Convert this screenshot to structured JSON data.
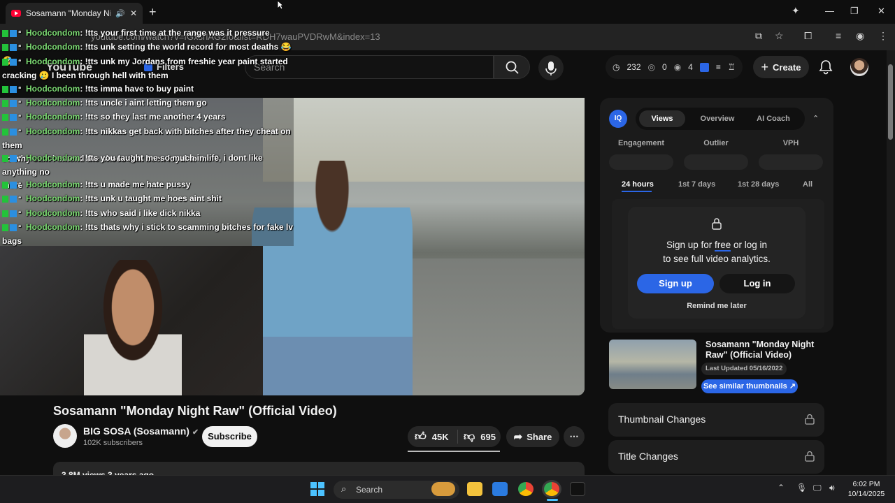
{
  "browser": {
    "tab_title": "Sosamann \"Monday Night R",
    "url": "youtube.com/watch?v=fGxsrlAG2fo&list=RDH7wauPVDRwM&index=13"
  },
  "masthead": {
    "logo": "YouTube",
    "filters_label": "Filters",
    "search_placeholder": "Search",
    "stats": {
      "clock": "232",
      "views": "0",
      "eye": "4"
    },
    "create_label": "Create"
  },
  "chat": [
    {
      "user": "Hoodcondom",
      "msg": ": !tts your first time at the range was it pressure"
    },
    {
      "user": "Hoodcondom",
      "msg": ": !tts unk setting the world record for most deaths 😂 🤣"
    },
    {
      "user": "Hoodcondom",
      "msg": ": !tts unk my Jordans from freshie year paint started",
      "cont": "cracking 🥲 I been through hell with them"
    },
    {
      "user": "Hoodcondom",
      "msg": ": !tts imma have to buy paint"
    },
    {
      "user": "Hoodcondom",
      "msg": ": !tts uncle i aint letting them go"
    },
    {
      "user": "Hoodcondom",
      "msg": ": !tts so they last me another 4 years"
    },
    {
      "user": "Hoodcondom",
      "msg": ": !tts nikkas get back with bitches after they cheat on them",
      "cont": "so why cant i extend the shoes that been loyal to me ?"
    },
    {
      "user": "Hoodcondom",
      "msg": ": !tts you taught me so much in life, i dont like anything no",
      "cont": "more"
    },
    {
      "user": "Hoodcondom",
      "msg": ": !tts u made me hate pussy"
    },
    {
      "user": "Hoodcondom",
      "msg": ": !tts unk u taught me hoes aint shit"
    },
    {
      "user": "Hoodcondom",
      "msg": ": !tts who said i like dick nikka"
    },
    {
      "user": "Hoodcondom",
      "msg": ": !tts thats why i stick to scamming bitches for fake lv",
      "cont": "bags"
    }
  ],
  "video": {
    "title": "Sosamann \"Monday Night Raw\" (Official Video)",
    "channel": "BIG SOSA (Sosamann)",
    "subscribers": "102K subscribers",
    "subscribe_label": "Subscribe",
    "likes": "45K",
    "dislikes": "695",
    "share_label": "Share",
    "desc_preview": "3.8M views  3 years ago"
  },
  "panel": {
    "logo": "IQ",
    "tabs": [
      "Views",
      "Overview",
      "AI Coach"
    ],
    "active_tab": "Views",
    "stats_labels": [
      "Engagement",
      "Outlier",
      "VPH"
    ],
    "ranges": [
      "24 hours",
      "1st 7 days",
      "1st 28 days",
      "All"
    ],
    "active_range": "24 hours",
    "modal": {
      "line1_a": "Sign up for ",
      "line1_link": "free",
      "line1_b": " or log in",
      "line2": "to see full video analytics.",
      "signup": "Sign up",
      "login": "Log in",
      "remind": "Remind me later"
    },
    "card": {
      "title": "Sosamann \"Monday Night Raw\" (Official Video)",
      "updated": "Last Updated 05/16/2022",
      "similar": "See similar thumbnails ↗"
    },
    "locked": [
      "Thumbnail Changes",
      "Title Changes"
    ]
  },
  "taskbar": {
    "search": "Search",
    "time": "6:02 PM",
    "date": "10/14/2025"
  },
  "colors": {
    "accent": "#2b66e6",
    "chat_user": "#7ddc74",
    "yt_red": "#ff0033"
  }
}
